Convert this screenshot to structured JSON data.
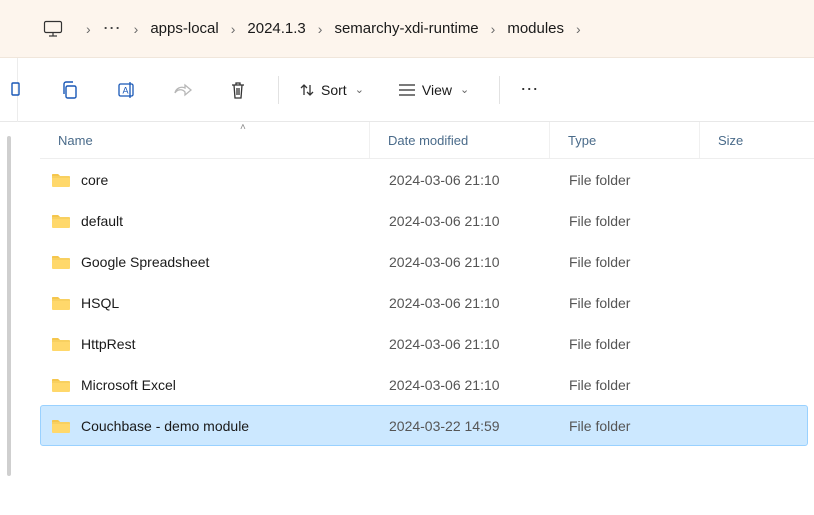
{
  "breadcrumb": {
    "items": [
      {
        "label": "apps-local"
      },
      {
        "label": "2024.1.3"
      },
      {
        "label": "semarchy-xdi-runtime"
      },
      {
        "label": "modules"
      }
    ]
  },
  "toolbar": {
    "sort_label": "Sort",
    "view_label": "View"
  },
  "columns": {
    "name": "Name",
    "date": "Date modified",
    "type": "Type",
    "size": "Size"
  },
  "rows": [
    {
      "name": "core",
      "date": "2024-03-06 21:10",
      "type": "File folder",
      "size": "",
      "selected": false
    },
    {
      "name": "default",
      "date": "2024-03-06 21:10",
      "type": "File folder",
      "size": "",
      "selected": false
    },
    {
      "name": "Google Spreadsheet",
      "date": "2024-03-06 21:10",
      "type": "File folder",
      "size": "",
      "selected": false
    },
    {
      "name": "HSQL",
      "date": "2024-03-06 21:10",
      "type": "File folder",
      "size": "",
      "selected": false
    },
    {
      "name": "HttpRest",
      "date": "2024-03-06 21:10",
      "type": "File folder",
      "size": "",
      "selected": false
    },
    {
      "name": "Microsoft Excel",
      "date": "2024-03-06 21:10",
      "type": "File folder",
      "size": "",
      "selected": false
    },
    {
      "name": "Couchbase - demo module",
      "date": "2024-03-22 14:59",
      "type": "File folder",
      "size": "",
      "selected": true
    }
  ]
}
